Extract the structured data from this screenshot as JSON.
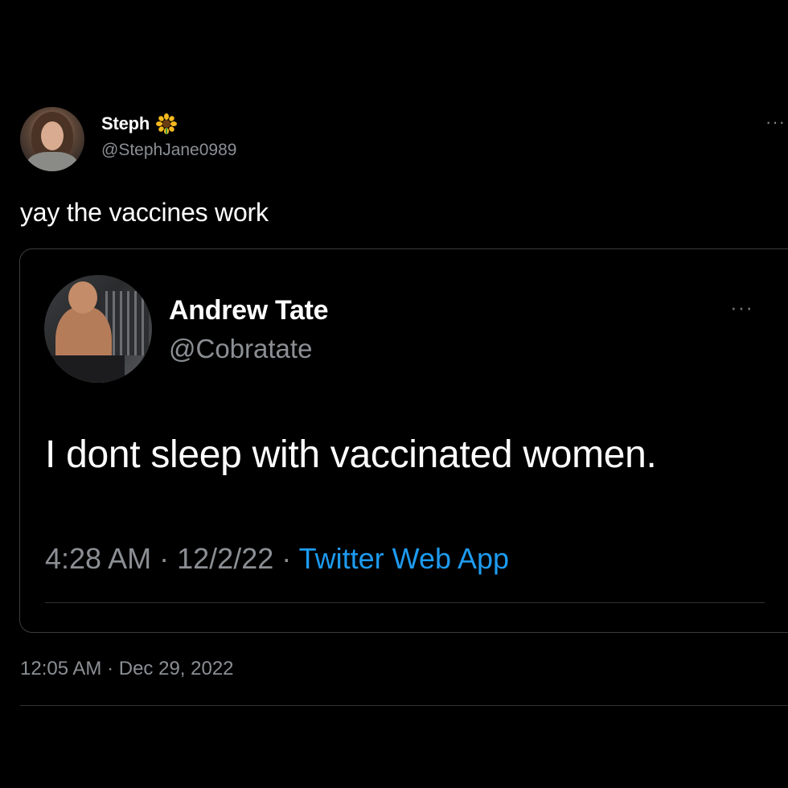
{
  "tweet": {
    "author": {
      "name": "Steph",
      "emoji_icon": "sunflower-icon",
      "handle": "@StephJane0989"
    },
    "text": "yay the vaccines work",
    "timestamp": "12:05 AM",
    "separator": "·",
    "date": "Dec 29, 2022",
    "more_icon": "more-horizontal-icon"
  },
  "quoted_tweet": {
    "author": {
      "name": "Andrew Tate",
      "handle": "@Cobratate"
    },
    "text": "I dont sleep with vaccinated women.",
    "time": "4:28 AM",
    "separator_1": "·",
    "date": "12/2/22",
    "separator_2": "·",
    "source": "Twitter Web App",
    "more_icon": "more-horizontal-icon"
  },
  "colors": {
    "background": "#000000",
    "text_primary": "#ffffff",
    "text_secondary": "#8b8f94",
    "link": "#1d9bf0",
    "border": "#3a3d41"
  }
}
